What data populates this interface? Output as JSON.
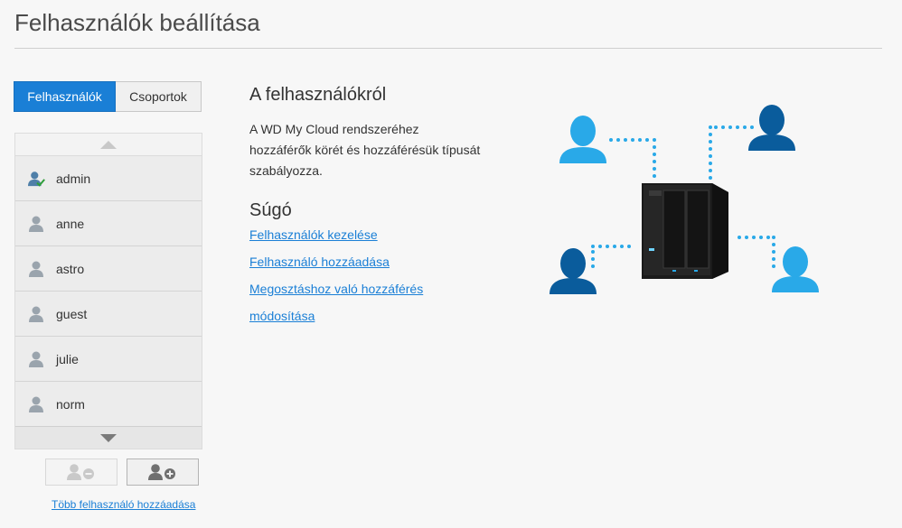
{
  "page": {
    "title": "Felhasználók beállítása"
  },
  "tabs": {
    "users": "Felhasználók",
    "groups": "Csoportok"
  },
  "users": [
    {
      "name": "admin",
      "is_admin": true
    },
    {
      "name": "anne",
      "is_admin": false
    },
    {
      "name": "astro",
      "is_admin": false
    },
    {
      "name": "guest",
      "is_admin": false
    },
    {
      "name": "julie",
      "is_admin": false
    },
    {
      "name": "norm",
      "is_admin": false
    }
  ],
  "actions": {
    "more_users_link": "Több felhasználó hozzáadása"
  },
  "about": {
    "title": "A felhasználókról",
    "lines": [
      "A WD My Cloud rendszeréhez",
      "hozzáférők körét és hozzáférésük típusát",
      "szabályozza."
    ]
  },
  "help": {
    "title": "Súgó",
    "links": [
      "Felhasználók kezelése",
      "Felhasználó hozzáadása",
      "Megosztáshoz való hozzáférés",
      "módosítása"
    ]
  },
  "colors": {
    "accent": "#1a7fd6",
    "user_light": "#29a9e8",
    "user_dark": "#0a5c9c",
    "check": "#2f9e3a"
  }
}
